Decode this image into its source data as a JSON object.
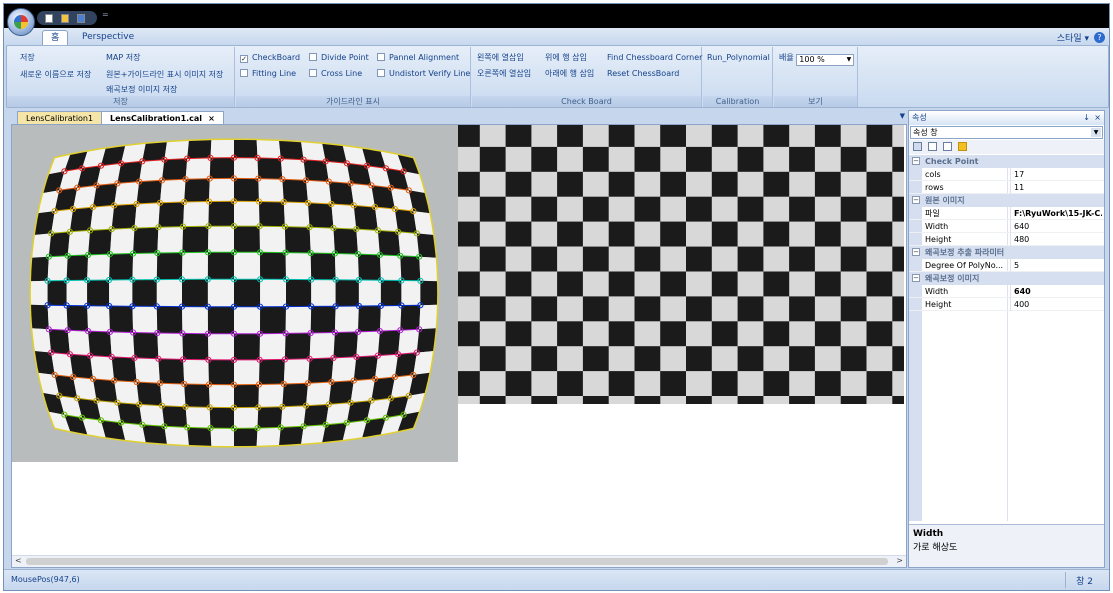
{
  "titlebar": {
    "qat_icons": [
      "new-file-icon",
      "open-folder-icon",
      "save-icon"
    ],
    "qat_dropdown": "="
  },
  "ribbon_tabs": {
    "home": "홈",
    "perspective": "Perspective",
    "style": "스타일",
    "help": "?"
  },
  "groups": {
    "save": {
      "label": "저장",
      "items": [
        "저장",
        "새로운 이름으로 저장",
        "MAP 저장",
        "원본+가이드라인 표시 이미지 저장",
        "왜곡보정 이미지 저장"
      ]
    },
    "guideline": {
      "label": "가이드라인 표시",
      "checks": [
        {
          "label": "CheckBoard",
          "checked": true
        },
        {
          "label": "Divide Point",
          "checked": false
        },
        {
          "label": "Pannel Alignment",
          "checked": false
        },
        {
          "label": "Fitting Line",
          "checked": false
        },
        {
          "label": "Cross Line",
          "checked": false
        },
        {
          "label": "Undistort Verify Line",
          "checked": false
        }
      ]
    },
    "checkboard": {
      "label": "Check Board",
      "items": [
        "왼쪽에 열삽입",
        "오른쪽에 열삽입",
        "위에 행 삽입",
        "아래에 행 삽입",
        "Find Chessboard Corner",
        "Reset ChessBoard"
      ]
    },
    "calibration": {
      "label": "Calibration",
      "items": [
        "Run_Polynomial"
      ]
    },
    "view": {
      "label": "보기",
      "zoom_label": "배율",
      "zoom_value": "100 %"
    }
  },
  "doc_tabs": [
    "LensCalibration1",
    "LensCalibration1.cal"
  ],
  "doc_tab_close": "×",
  "props": {
    "title": "속성",
    "pin": "↓",
    "close": "×",
    "selector": "속성 창",
    "categories": [
      {
        "name": "Check Point",
        "rows": [
          {
            "k": "cols",
            "v": "17"
          },
          {
            "k": "rows",
            "v": "11"
          }
        ]
      },
      {
        "name": "원본 이미지",
        "rows": [
          {
            "k": "파일",
            "v": "F:\\RyuWork\\15-JK-C...",
            "bold": true
          },
          {
            "k": "Width",
            "v": "640"
          },
          {
            "k": "Height",
            "v": "480"
          }
        ]
      },
      {
        "name": "왜곡보정 추출 파라미터",
        "rows": [
          {
            "k": "Degree Of PolyNo...",
            "v": "5"
          }
        ]
      },
      {
        "name": "왜곡보정 이미지",
        "rows": [
          {
            "k": "Width",
            "v": "640",
            "bold": true
          },
          {
            "k": "Height",
            "v": "400"
          }
        ]
      }
    ],
    "desc_title": "Width",
    "desc_text": "가로 해상도"
  },
  "status": {
    "mousepos": "MousePos(947,6)",
    "right": "창 2"
  },
  "line_colors": [
    "#e02020",
    "#e05a10",
    "#d8a000",
    "#a0b000",
    "#20c020",
    "#00c0b0",
    "#0030d0",
    "#b020d0",
    "#e01870",
    "#e06010",
    "#c0a000",
    "#60c000",
    "#00c000"
  ]
}
